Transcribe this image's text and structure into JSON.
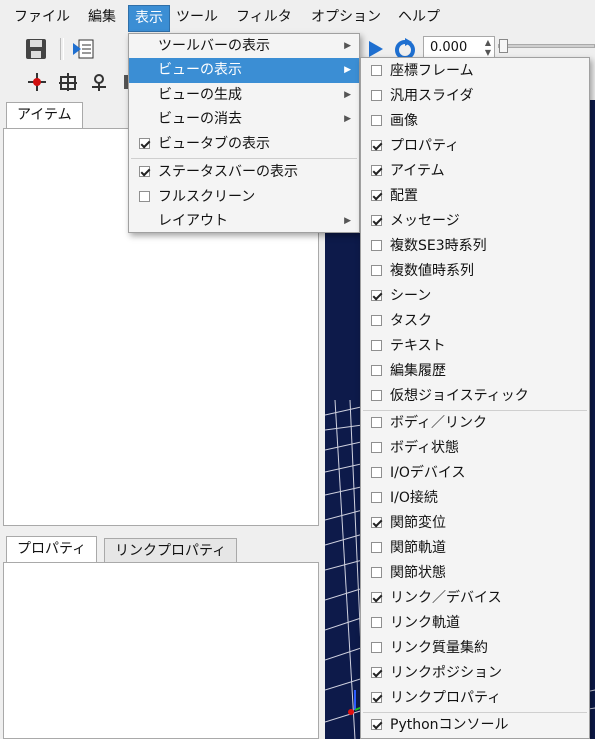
{
  "menubar": [
    "ファイル",
    "編集",
    "表示",
    "ツール",
    "フィルタ",
    "オプション",
    "ヘルプ"
  ],
  "time_value": "0.000",
  "tabs_top": [
    "アイテム"
  ],
  "tabs_bottom": [
    "プロパティ",
    "リンクプロパティ"
  ],
  "view_menu": [
    {
      "label": "ツールバーの表示",
      "submenu": true
    },
    {
      "label": "ビューの表示",
      "submenu": true,
      "highlighted": true
    },
    {
      "label": "ビューの生成",
      "submenu": true
    },
    {
      "label": "ビューの消去",
      "submenu": true
    },
    {
      "label": "ビュータブの表示",
      "checkbox": true,
      "checked": true
    },
    {
      "separator": true
    },
    {
      "label": "ステータスバーの表示",
      "checkbox": true,
      "checked": true
    },
    {
      "label": "フルスクリーン",
      "checkbox": true,
      "checked": false
    },
    {
      "label": "レイアウト",
      "submenu": true
    }
  ],
  "show_view_menu": [
    {
      "label": "座標フレーム",
      "checked": false
    },
    {
      "label": "汎用スライダ",
      "checked": false
    },
    {
      "label": "画像",
      "checked": false
    },
    {
      "label": "プロパティ",
      "checked": true
    },
    {
      "label": "アイテム",
      "checked": true
    },
    {
      "label": "配置",
      "checked": true
    },
    {
      "label": "メッセージ",
      "checked": true
    },
    {
      "label": "複数SE3時系列",
      "checked": false
    },
    {
      "label": "複数値時系列",
      "checked": false
    },
    {
      "label": "シーン",
      "checked": true
    },
    {
      "label": "タスク",
      "checked": false
    },
    {
      "label": "テキスト",
      "checked": false
    },
    {
      "label": "編集履歴",
      "checked": false
    },
    {
      "label": "仮想ジョイスティック",
      "checked": false
    },
    {
      "separator": true
    },
    {
      "label": "ボディ／リンク",
      "checked": false
    },
    {
      "label": "ボディ状態",
      "checked": false
    },
    {
      "label": "I/Oデバイス",
      "checked": false
    },
    {
      "label": "I/O接続",
      "checked": false
    },
    {
      "label": "関節変位",
      "checked": true
    },
    {
      "label": "関節軌道",
      "checked": false
    },
    {
      "label": "関節状態",
      "checked": false
    },
    {
      "label": "リンク／デバイス",
      "checked": true
    },
    {
      "label": "リンク軌道",
      "checked": false
    },
    {
      "label": "リンク質量集約",
      "checked": false
    },
    {
      "label": "リンクポジション",
      "checked": true
    },
    {
      "label": "リンクプロパティ",
      "checked": true
    },
    {
      "separator": true
    },
    {
      "label": "Pythonコンソール",
      "checked": true
    }
  ]
}
